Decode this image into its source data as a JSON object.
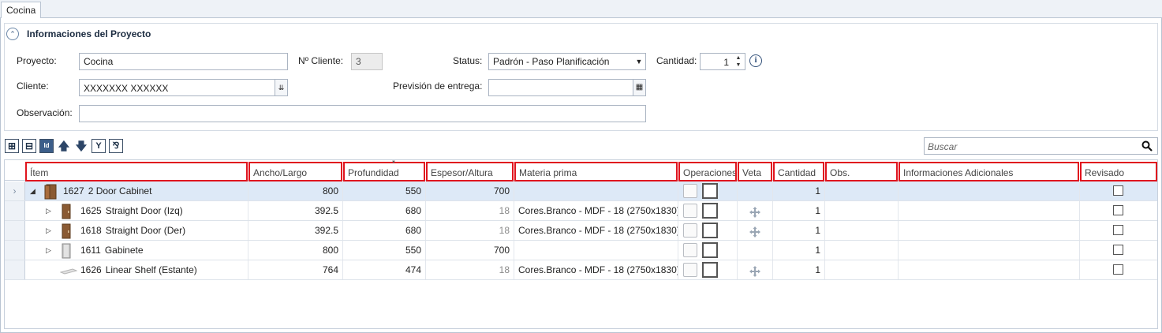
{
  "tab": {
    "label": "Cocina"
  },
  "panel": {
    "title": "Informaciones del Proyecto",
    "proyecto": {
      "label": "Proyecto:",
      "value": "Cocina"
    },
    "cliente_num": {
      "label": "Nº Cliente:",
      "value": "3"
    },
    "status": {
      "label": "Status:",
      "value": "Padrón - Paso Planificación"
    },
    "cantidad": {
      "label": "Cantidad:",
      "value": "1"
    },
    "cliente": {
      "label": "Cliente:",
      "value": "XXXXXXX XXXXXX"
    },
    "prevision": {
      "label": "Previsión de entrega:",
      "value": ""
    },
    "observacion": {
      "label": "Observación:",
      "value": ""
    }
  },
  "toolbar": {
    "icons": [
      "expand-all-icon",
      "collapse-all-icon",
      "id-toggle-icon",
      "move-up-icon",
      "move-down-icon",
      "merge-icon",
      "split-icon"
    ],
    "id_label": "Id"
  },
  "search": {
    "placeholder": "Buscar"
  },
  "columns": [
    "Ítem",
    "Ancho/Largo",
    "Profundidad",
    "Espesor/Altura",
    "Materia prima",
    "Operaciones",
    "Veta",
    "Cantidad",
    "Obs.",
    "Informaciones Adicionales",
    "Revisado"
  ],
  "rows": [
    {
      "id": "1627",
      "name": "2 Door Cabinet",
      "ancho": "800",
      "profundidad": "550",
      "espesor": "700",
      "espesor_grey": false,
      "materia": "",
      "veta": false,
      "cantidad": "1",
      "revisado": false,
      "level": 0,
      "expanded": true,
      "selected": true,
      "icon": "cabinet-icon"
    },
    {
      "id": "1625",
      "name": "Straight Door (Izq)",
      "ancho": "392.5",
      "profundidad": "680",
      "espesor": "18",
      "espesor_grey": true,
      "materia": "Cores.Branco - MDF - 18 (2750x1830)",
      "veta": true,
      "cantidad": "1",
      "revisado": false,
      "level": 1,
      "expanded": false,
      "selected": false,
      "icon": "door-icon"
    },
    {
      "id": "1618",
      "name": "Straight Door (Der)",
      "ancho": "392.5",
      "profundidad": "680",
      "espesor": "18",
      "espesor_grey": true,
      "materia": "Cores.Branco - MDF - 18 (2750x1830)",
      "veta": true,
      "cantidad": "1",
      "revisado": false,
      "level": 1,
      "expanded": false,
      "selected": false,
      "icon": "door-icon"
    },
    {
      "id": "1611",
      "name": "Gabinete",
      "ancho": "800",
      "profundidad": "550",
      "espesor": "700",
      "espesor_grey": false,
      "materia": "",
      "veta": false,
      "cantidad": "1",
      "revisado": false,
      "level": 1,
      "expanded": false,
      "selected": false,
      "icon": "gabinete-icon"
    },
    {
      "id": "1626",
      "name": "Linear Shelf (Estante)",
      "ancho": "764",
      "profundidad": "474",
      "espesor": "18",
      "espesor_grey": true,
      "materia": "Cores.Branco - MDF - 18 (2750x1830)",
      "veta": true,
      "cantidad": "1",
      "revisado": false,
      "level": 1,
      "expanded": null,
      "selected": false,
      "icon": "shelf-icon"
    }
  ]
}
